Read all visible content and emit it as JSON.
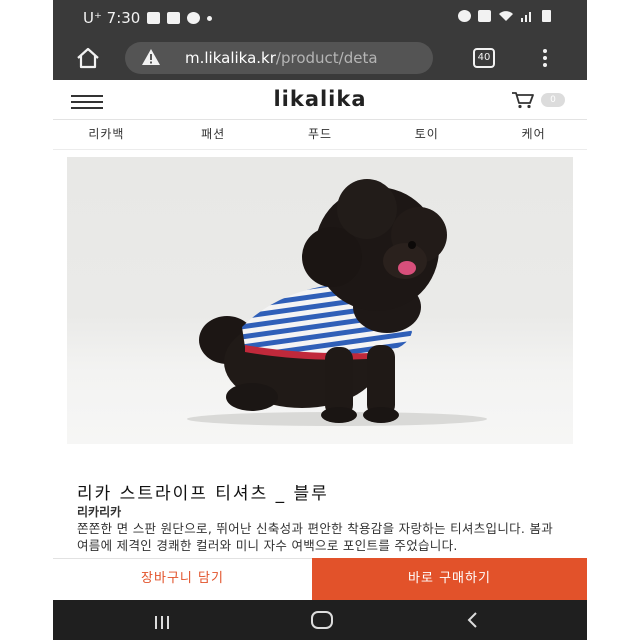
{
  "status_bar": {
    "carrier_time": "U⁺ 7:30",
    "left_icons": [
      "phone-call-icon",
      "image-icon",
      "chat-bubble-icon",
      "dot-icon"
    ],
    "right_icons": [
      "alarm-icon",
      "lock-icon",
      "wifi-icon",
      "signal-icon",
      "battery-icon"
    ]
  },
  "browser": {
    "url_host": "m.likalika.kr",
    "url_path": "/product/deta",
    "tab_count": "40"
  },
  "site": {
    "logo": "likalika",
    "cart_count": "0"
  },
  "categories": [
    "리카백",
    "패션",
    "푸드",
    "토이",
    "케어"
  ],
  "product": {
    "title": "리카 스트라이프 티셔츠 _ 블루",
    "brand": "리카리카",
    "description": "쫀쫀한 면 스판 원단으로, 뛰어난 신축성과 편안한 착용감을 자랑하는 티셔츠입니다. 봄과 여름에 제격인 경쾌한 컬러와 미니 자수 여백으로 포인트를 주었습니다."
  },
  "actions": {
    "add_to_cart": "장바구니 담기",
    "buy_now": "바로 구매하기"
  },
  "colors": {
    "accent": "#e2522a",
    "status_bar": "#3a3a3a",
    "nav_bar": "#1f1f1f"
  }
}
